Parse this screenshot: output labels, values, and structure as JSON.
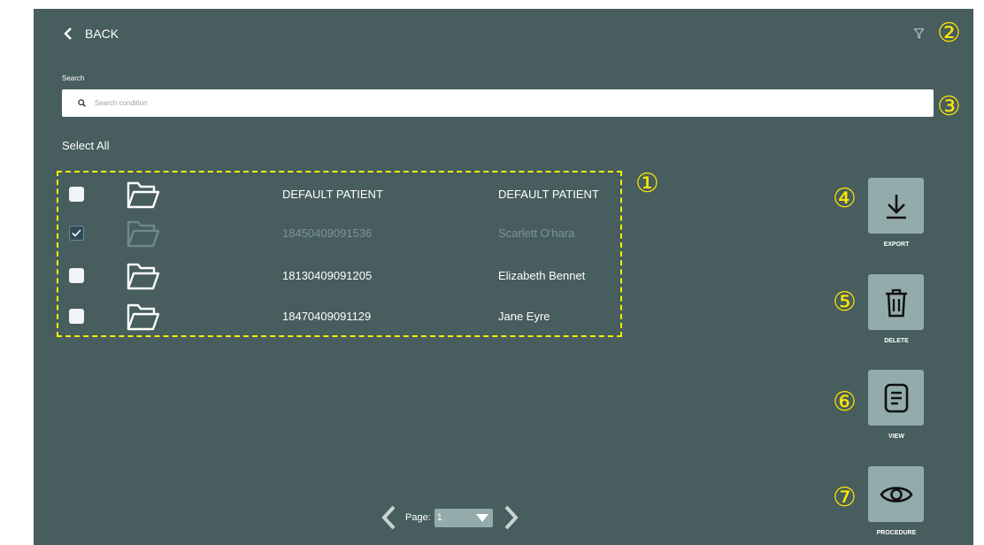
{
  "header": {
    "back_label": "BACK"
  },
  "search": {
    "label": "Search",
    "placeholder": "Search condition"
  },
  "select_all_label": "Select All",
  "patients": [
    {
      "id": "DEFAULT PATIENT",
      "name": "DEFAULT PATIENT",
      "checked": false,
      "dimmed": false
    },
    {
      "id": "18450409091536",
      "name": "Scarlett O'hara",
      "checked": true,
      "dimmed": true
    },
    {
      "id": "18130409091205",
      "name": "Elizabeth Bennet",
      "checked": false,
      "dimmed": false
    },
    {
      "id": "18470409091129",
      "name": "Jane Eyre",
      "checked": false,
      "dimmed": false
    }
  ],
  "actions": [
    {
      "label": "EXPORT",
      "icon": "download-icon"
    },
    {
      "label": "DELETE",
      "icon": "trash-icon"
    },
    {
      "label": "VIEW",
      "icon": "document-icon"
    },
    {
      "label": "PROCEDURE",
      "icon": "eye-icon"
    }
  ],
  "markers": [
    "①",
    "②",
    "③",
    "④",
    "⑤",
    "⑥",
    "⑦"
  ],
  "pagination": {
    "page_label": "Page:",
    "current_page": "1"
  },
  "colors": {
    "background": "#475d5e",
    "button": "#93abab",
    "marker": "#ffe600",
    "highlight_border": "#f2f000"
  }
}
